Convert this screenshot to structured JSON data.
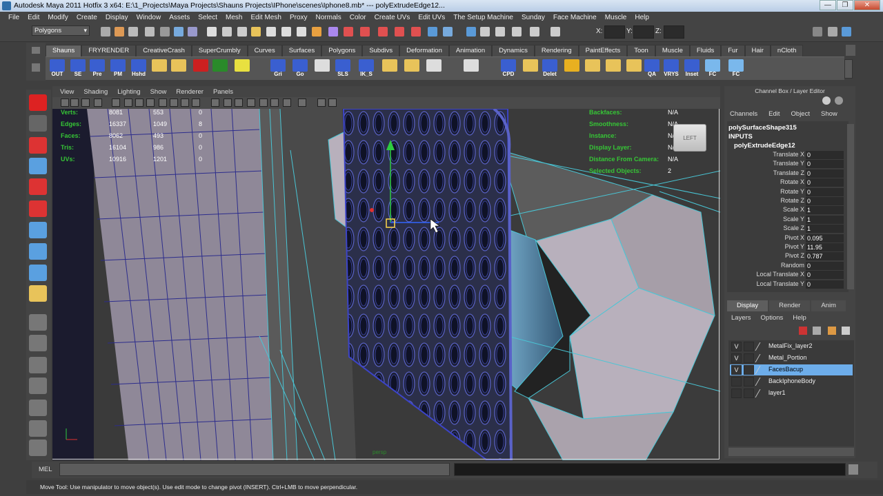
{
  "window": {
    "title": "Autodesk Maya 2011 Hotfix 3 x64: E:\\1_Projects\\Maya Projects\\Shauns Projects\\IPhone\\scenes\\Iphone8.mb*   ---   polyExtrudeEdge12...",
    "controls": [
      "—",
      "❐",
      "✕"
    ]
  },
  "menubar": [
    "File",
    "Edit",
    "Modify",
    "Create",
    "Display",
    "Window",
    "Assets",
    "Select",
    "Mesh",
    "Edit Mesh",
    "Proxy",
    "Normals",
    "Color",
    "Create UVs",
    "Edit UVs",
    "The Setup Machine",
    "Sunday",
    "Face Machine",
    "Muscle",
    "Help"
  ],
  "status_line": {
    "mode": "Polygons",
    "x_label": "X:",
    "y_label": "Y:",
    "z_label": "Z:"
  },
  "shelf_tabs": [
    "Shauns",
    "FRYRENDER",
    "CreativeCrash",
    "SuperCrumbly",
    "Curves",
    "Surfaces",
    "Polygons",
    "Subdivs",
    "Deformation",
    "Animation",
    "Dynamics",
    "Rendering",
    "PaintEffects",
    "Toon",
    "Muscle",
    "Fluids",
    "Fur",
    "Hair",
    "nCloth"
  ],
  "active_shelf_tab": "Shauns",
  "shelf_buttons": [
    "OUT",
    "SE",
    "Pre",
    "PM",
    "Hshd",
    "",
    "",
    "",
    "",
    "",
    "Gri",
    "Go",
    "",
    "SLS",
    "IK_S",
    "",
    "",
    "",
    "",
    "CPD",
    "",
    "Delet",
    "",
    "",
    "",
    "",
    "QA",
    "VRYS",
    "Inset",
    "FC",
    "FC"
  ],
  "panel_menu": [
    "View",
    "Shading",
    "Lighting",
    "Show",
    "Renderer",
    "Panels"
  ],
  "viewport": {
    "hud_left": [
      {
        "label": "Verts:",
        "a": "8081",
        "b": "553",
        "c": "0"
      },
      {
        "label": "Edges:",
        "a": "16337",
        "b": "1049",
        "c": "8"
      },
      {
        "label": "Faces:",
        "a": "8062",
        "b": "493",
        "c": "0"
      },
      {
        "label": "Tris:",
        "a": "16104",
        "b": "986",
        "c": "0"
      },
      {
        "label": "UVs:",
        "a": "10916",
        "b": "1201",
        "c": "0"
      }
    ],
    "hud_right": [
      {
        "label": "Backfaces:",
        "value": "N/A"
      },
      {
        "label": "Smoothness:",
        "value": "N/A"
      },
      {
        "label": "Instance:",
        "value": "N/A"
      },
      {
        "label": "Display Layer:",
        "value": "N/A"
      },
      {
        "label": "Distance From Camera:",
        "value": "N/A"
      },
      {
        "label": "Selected Objects:",
        "value": "2"
      }
    ],
    "viewcube_label": "LEFT",
    "camera_name": "persp"
  },
  "channel_box": {
    "title": "Channel Box / Layer Editor",
    "menu": [
      "Channels",
      "Edit",
      "Object",
      "Show"
    ],
    "object": "polySurfaceShape315",
    "inputs_label": "INPUTS",
    "node": "polyExtrudeEdge12",
    "channels": [
      {
        "name": "Translate X",
        "value": "0"
      },
      {
        "name": "Translate Y",
        "value": "0"
      },
      {
        "name": "Translate Z",
        "value": "0"
      },
      {
        "name": "Rotate X",
        "value": "0"
      },
      {
        "name": "Rotate Y",
        "value": "0"
      },
      {
        "name": "Rotate Z",
        "value": "0"
      },
      {
        "name": "Scale X",
        "value": "1"
      },
      {
        "name": "Scale Y",
        "value": "1"
      },
      {
        "name": "Scale Z",
        "value": "1"
      },
      {
        "name": "Pivot X",
        "value": "0.095"
      },
      {
        "name": "Pivot Y",
        "value": "11.95"
      },
      {
        "name": "Pivot Z",
        "value": "0.787"
      },
      {
        "name": "Random",
        "value": "0"
      },
      {
        "name": "Local Translate X",
        "value": "0"
      },
      {
        "name": "Local Translate Y",
        "value": "0"
      }
    ]
  },
  "layer_editor": {
    "tabs": [
      "Display",
      "Render",
      "Anim"
    ],
    "active_tab": "Display",
    "menu": [
      "Layers",
      "Options",
      "Help"
    ],
    "layers": [
      {
        "visible": "V",
        "name": "MetalFix_layer2",
        "selected": false
      },
      {
        "visible": "V",
        "name": "Metal_Portion",
        "selected": false
      },
      {
        "visible": "V",
        "name": "FacesBacup",
        "selected": true
      },
      {
        "visible": "",
        "name": "BackIphoneBody",
        "selected": false
      },
      {
        "visible": "",
        "name": "layer1",
        "selected": false
      }
    ]
  },
  "command_line": {
    "label": "MEL"
  },
  "help_line": "Move Tool: Use manipulator to move object(s). Use edit mode to change pivot (INSERT).  Ctrl+LMB to move perpendicular."
}
